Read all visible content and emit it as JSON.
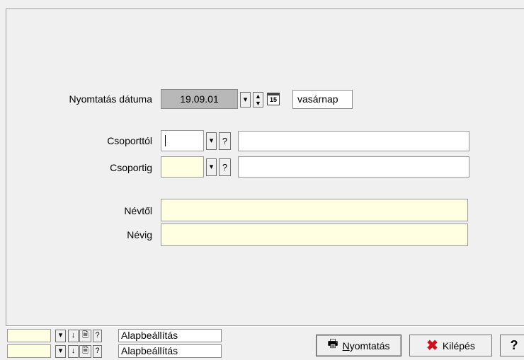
{
  "form": {
    "date_label": "Nyomtatás dátuma",
    "date_value": "19.09.01",
    "calendar_icon_text": "15",
    "day_name": "vasárnap",
    "csoporttol_label": "Csoporttól",
    "csoportig_label": "Csoportig",
    "nevtol_label": "Névtől",
    "nevig_label": "Névig",
    "help_glyph": "?"
  },
  "footer": {
    "preset1": "Alapbeállítás",
    "preset2": "Alapbeállítás",
    "print_first": "N",
    "print_rest": "yomtatás",
    "exit_label": "Kilépés",
    "help_label": "?"
  },
  "colors": {
    "input_yellow": "#ffffe1",
    "date_gray": "#b8b8b8",
    "exit_red": "#c8141e"
  }
}
